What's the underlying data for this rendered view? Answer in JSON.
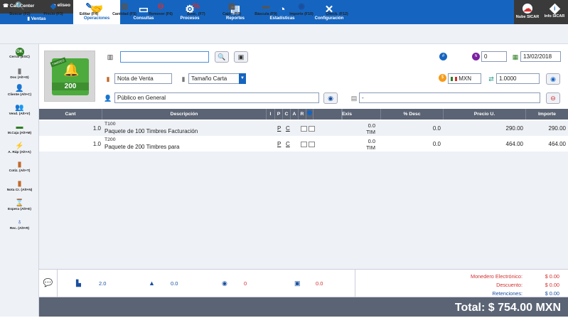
{
  "user": {
    "call_center": "Call Center",
    "username": "eliseo",
    "store": "Ventas"
  },
  "nav": {
    "tabs": [
      {
        "label": "Operaciones",
        "icon": "handshake-icon",
        "active": true
      },
      {
        "label": "Consultas",
        "icon": "monitor-icon"
      },
      {
        "label": "Procesos",
        "icon": "gear-icon"
      },
      {
        "label": "Reportes",
        "icon": "clipboard-icon"
      },
      {
        "label": "Estadísticas",
        "icon": "pie-chart-icon"
      },
      {
        "label": "Configuración",
        "icon": "tools-icon"
      }
    ]
  },
  "right": {
    "cloud": "Nube SICAR",
    "info": "Info SICAR"
  },
  "toolbar": {
    "items": [
      {
        "label": "Buscar (F2)",
        "icon": "search-icon"
      },
      {
        "label": "Precio (F3)",
        "icon": "price-tag-icon"
      },
      {
        "label": "Editar (F4)",
        "icon": "pencil-icon"
      },
      {
        "label": "Cantidad (F5)",
        "icon": "quantity-icon"
      },
      {
        "label": "Remover (F6)",
        "icon": "remove-icon"
      },
      {
        "label": "Desc. (F7)",
        "icon": "percent-icon"
      },
      {
        "label": "Cajón (F8)",
        "icon": "drawer-icon"
      },
      {
        "label": "Báscula (F9)",
        "icon": "scale-icon"
      },
      {
        "label": "Importe (F10)",
        "icon": "money-icon"
      },
      {
        "label": "Check. (F12)",
        "icon": "check-icon"
      }
    ]
  },
  "sidebar": {
    "items": [
      {
        "label": "Cerrar (ESC)",
        "icon": "close-sale-icon"
      },
      {
        "label": "Doc (Alt+D)",
        "icon": "document-icon"
      },
      {
        "label": "Cliente (Alt+C)",
        "icon": "client-icon"
      },
      {
        "label": "Vend. (Alt+V)",
        "icon": "seller-icon"
      },
      {
        "label": "M.Caja (Alt+M)",
        "icon": "cash-box-icon"
      },
      {
        "label": "A. Ráp (Alt+A)",
        "icon": "lightning-icon"
      },
      {
        "label": "Cotiz. (Alt+T)",
        "icon": "quote-icon"
      },
      {
        "label": "Nota Cr. (Alt+N)",
        "icon": "credit-note-icon"
      },
      {
        "label": "Espera (Alt+E)",
        "icon": "hourglass-icon"
      },
      {
        "label": "Rec. (Alt+R)",
        "icon": "receipt-icon"
      }
    ]
  },
  "product_image": {
    "number": "200",
    "ribbon": "TIMBRES"
  },
  "form": {
    "search_value": "",
    "doc_number": "0",
    "date": "13/02/2018",
    "doc_type": "Nota de Venta",
    "print_size": "Tamaño Carta",
    "currency": "MXN",
    "exchange_rate": "1.0000",
    "client": "Público en General",
    "notes": "-"
  },
  "table": {
    "headers": {
      "cant": "Cant",
      "desc": "Descripción",
      "i": "I",
      "p": "P",
      "c": "C",
      "a": "A",
      "r": "R",
      "exis": "Exis",
      "pdesc": "% Desc",
      "precio": "Precio U.",
      "importe": "Importe"
    },
    "rows": [
      {
        "cant": "1.0",
        "code": "T100",
        "desc": "Paquete de 100 Timbres Facturación",
        "p": "P",
        "c": "C",
        "exis_qty": "0.0",
        "exis_unit": "TIM",
        "pdesc": "0.0",
        "precio": "290.00",
        "importe": "290.00"
      },
      {
        "cant": "1.0",
        "code": "T200",
        "desc": "Paquete de 200 Timbres para",
        "p": "P",
        "c": "C",
        "exis_qty": "0.0",
        "exis_unit": "TIM",
        "pdesc": "0.0",
        "precio": "464.00",
        "importe": "464.00"
      }
    ]
  },
  "footer": {
    "stat1": "2.0",
    "stat2": "0.0",
    "stat3": "0",
    "stat4": "0.0",
    "monedero_label": "Monedero Electrónico:",
    "monedero_value": "$ 0.00",
    "descuento_label": "Descuento:",
    "descuento_value": "$ 0.00",
    "retenciones_label": "Retenciones:",
    "retenciones_value": "$ 0.00",
    "total_label": "Total:",
    "total_value": "$ 754.00 MXN"
  },
  "colors": {
    "primary": "#1565c0",
    "header_gray": "#5b6474",
    "red": "#d32f2f",
    "green": "#4cab3c"
  }
}
